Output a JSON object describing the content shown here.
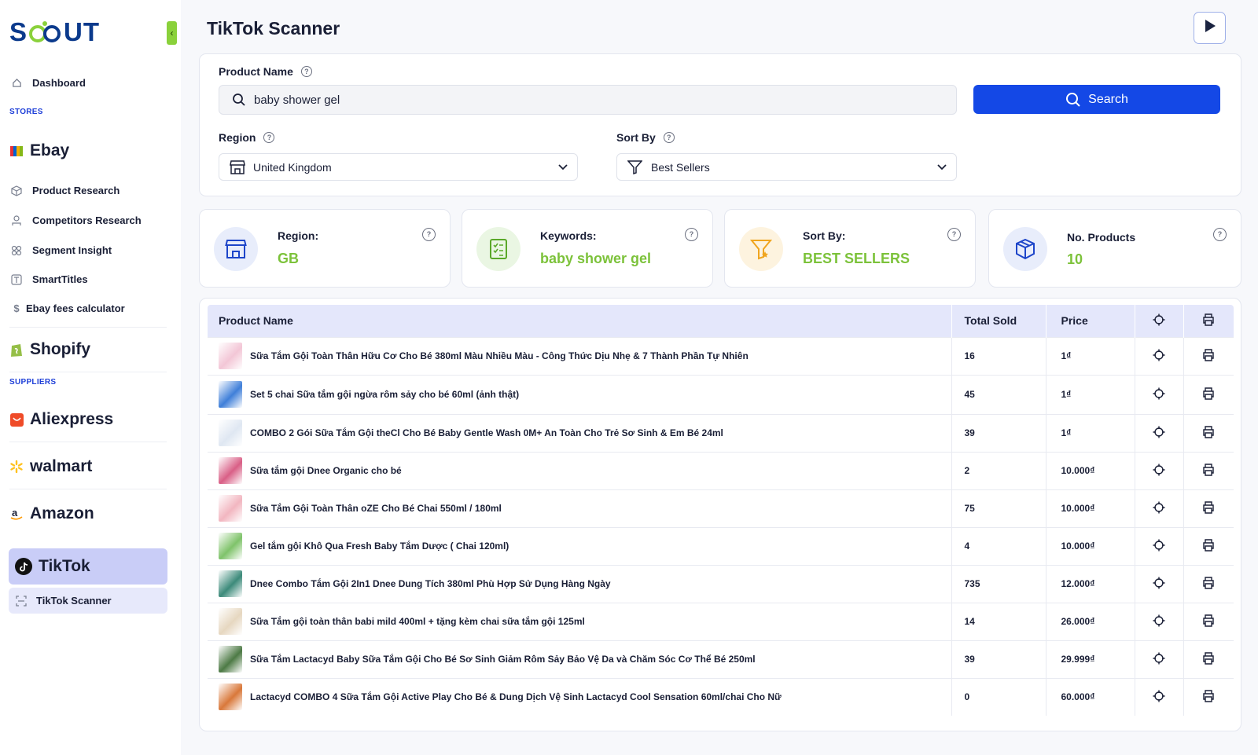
{
  "app": {
    "logo_s": "S",
    "logo_ut": "UT"
  },
  "sidebar": {
    "dashboard": "Dashboard",
    "stores_label": "STORES",
    "ebay": "Ebay",
    "ebay_items": [
      "Product Research",
      "Competitors Research",
      "Segment Insight",
      "SmartTitles",
      "Ebay fees calculator"
    ],
    "shopify": "Shopify",
    "suppliers_label": "SUPPLIERS",
    "aliexpress": "Aliexpress",
    "walmart": "walmart",
    "amazon": "Amazon",
    "tiktok": "TikTok",
    "tiktok_scanner": "TikTok Scanner"
  },
  "header": {
    "title": "TikTok Scanner"
  },
  "form": {
    "product_name_label": "Product Name",
    "product_name_value": "baby shower gel",
    "search_label": "Search",
    "region_label": "Region",
    "region_value": "United Kingdom",
    "sort_label": "Sort By",
    "sort_value": "Best Sellers"
  },
  "stats": {
    "region_label": "Region:",
    "region_value": "GB",
    "keywords_label": "Keywords:",
    "keywords_value": "baby shower gel",
    "sort_label": "Sort By:",
    "sort_value": "BEST SELLERS",
    "products_label": "No. Products",
    "products_value": "10"
  },
  "table": {
    "headers": {
      "name": "Product Name",
      "sold": "Total Sold",
      "price": "Price"
    },
    "rows": [
      {
        "name": "Sữa Tắm Gội Toàn Thân Hữu Cơ Cho Bé 380ml Màu Nhiều Màu - Công Thức Dịu Nhẹ & 7 Thành Phần Tự Nhiên",
        "sold": "16",
        "price": "1₫",
        "thumb": "#f3c6d6"
      },
      {
        "name": "Set 5 chai Sữa tắm gội ngừa rôm sảy cho bé 60ml (ảnh thật)",
        "sold": "45",
        "price": "1₫",
        "thumb": "#3f7fd9"
      },
      {
        "name": "COMBO 2 Gói Sữa Tắm Gội theCl Cho Bé Baby Gentle Wash 0M+ An Toàn Cho Trẻ Sơ Sinh & Em Bé 24ml",
        "sold": "39",
        "price": "1₫",
        "thumb": "#dfe7f2"
      },
      {
        "name": "Sữa tắm gội Dnee Organic cho bé",
        "sold": "2",
        "price": "10.000₫",
        "thumb": "#d95f86"
      },
      {
        "name": "Sữa Tắm Gội Toàn Thân oZE Cho Bé Chai 550ml / 180ml",
        "sold": "75",
        "price": "10.000₫",
        "thumb": "#f2b6c0"
      },
      {
        "name": "Gel tắm gội Khô Qua Fresh Baby Tắm Dược ( Chai 120ml)",
        "sold": "4",
        "price": "10.000₫",
        "thumb": "#7fc36a"
      },
      {
        "name": "Dnee Combo Tắm Gội 2In1 Dnee Dung Tích 380ml Phù Hợp Sử Dụng Hàng Ngày",
        "sold": "735",
        "price": "12.000₫",
        "thumb": "#3c8a7a"
      },
      {
        "name": "Sữa Tắm gội toàn thân babi mild 400ml + tặng kèm chai sữa tắm gội 125ml",
        "sold": "14",
        "price": "26.000₫",
        "thumb": "#e6d7c0"
      },
      {
        "name": "Sữa Tắm Lactacyd Baby Sữa Tắm Gội Cho Bé Sơ Sinh Giảm Rôm Sảy Bảo Vệ Da và Chăm Sóc Cơ Thể Bé 250ml",
        "sold": "39",
        "price": "29.999₫",
        "thumb": "#4d7a45"
      },
      {
        "name": "Lactacyd COMBO 4 Sữa Tắm Gội Active Play Cho Bé & Dung Dịch Vệ Sinh Lactacyd Cool Sensation 60ml/chai Cho Nữ",
        "sold": "0",
        "price": "60.000₫",
        "thumb": "#d9783a"
      }
    ]
  },
  "colors": {
    "accent": "#1448e6",
    "green": "#7cc23a",
    "active": "#c9cdf7"
  }
}
